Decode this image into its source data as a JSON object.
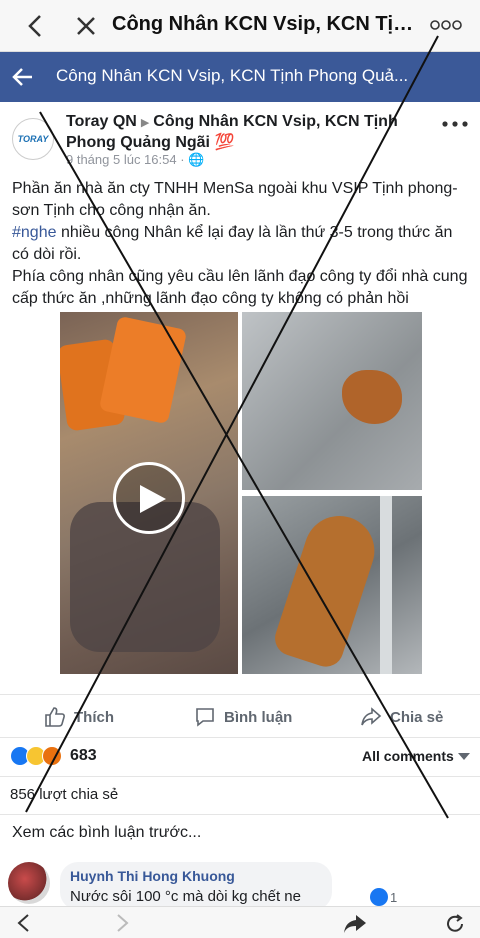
{
  "browser": {
    "title": "Công Nhân KCN Vsip, KCN Tịnh...",
    "back_icon": "chevron-left-icon",
    "close_icon": "close-icon",
    "more_icon": "more-dots-icon"
  },
  "group_bar": {
    "title": "Công Nhân KCN Vsip, KCN Tịnh Phong Quả...",
    "color": "#3b5998"
  },
  "post": {
    "avatar_text": "TORAY",
    "author": "Toray QN",
    "group": "Công Nhân KCN Vsip, KCN Tịnh Phong Quảng Ngãi 💯",
    "time": "9 tháng 5 lúc 16:54 · 🌐",
    "paragraphs": [
      "Phần ăn nhà ăn cty TNHH MenSa ngoài khu VSIP Tịnh phong-sơn Tịnh cho công nhận ăn.",
      "nhiều công Nhân kể lại đay là lần thứ 3-5 trong thức ăn có dòi rồi.",
      "Phía công nhân cũng yêu cầu lên lãnh đạo công ty đổi nhà cung cấp thức ăn ,những lãnh đạo công ty không có phản hồi"
    ],
    "hashtag": "#nghe"
  },
  "actions": {
    "like": "Thích",
    "comment": "Bình luận",
    "share": "Chia sẻ"
  },
  "reactions": {
    "count": "683",
    "all_comments": "All comments"
  },
  "shares_text": "856 lượt chia sẻ",
  "previous_comments": "Xem các bình luận trước...",
  "comment": {
    "author": "Huynh Thi Hong Khuong",
    "text": "Nước sôi 100 °c mà dòi kg chết ne",
    "like_count": "1"
  }
}
